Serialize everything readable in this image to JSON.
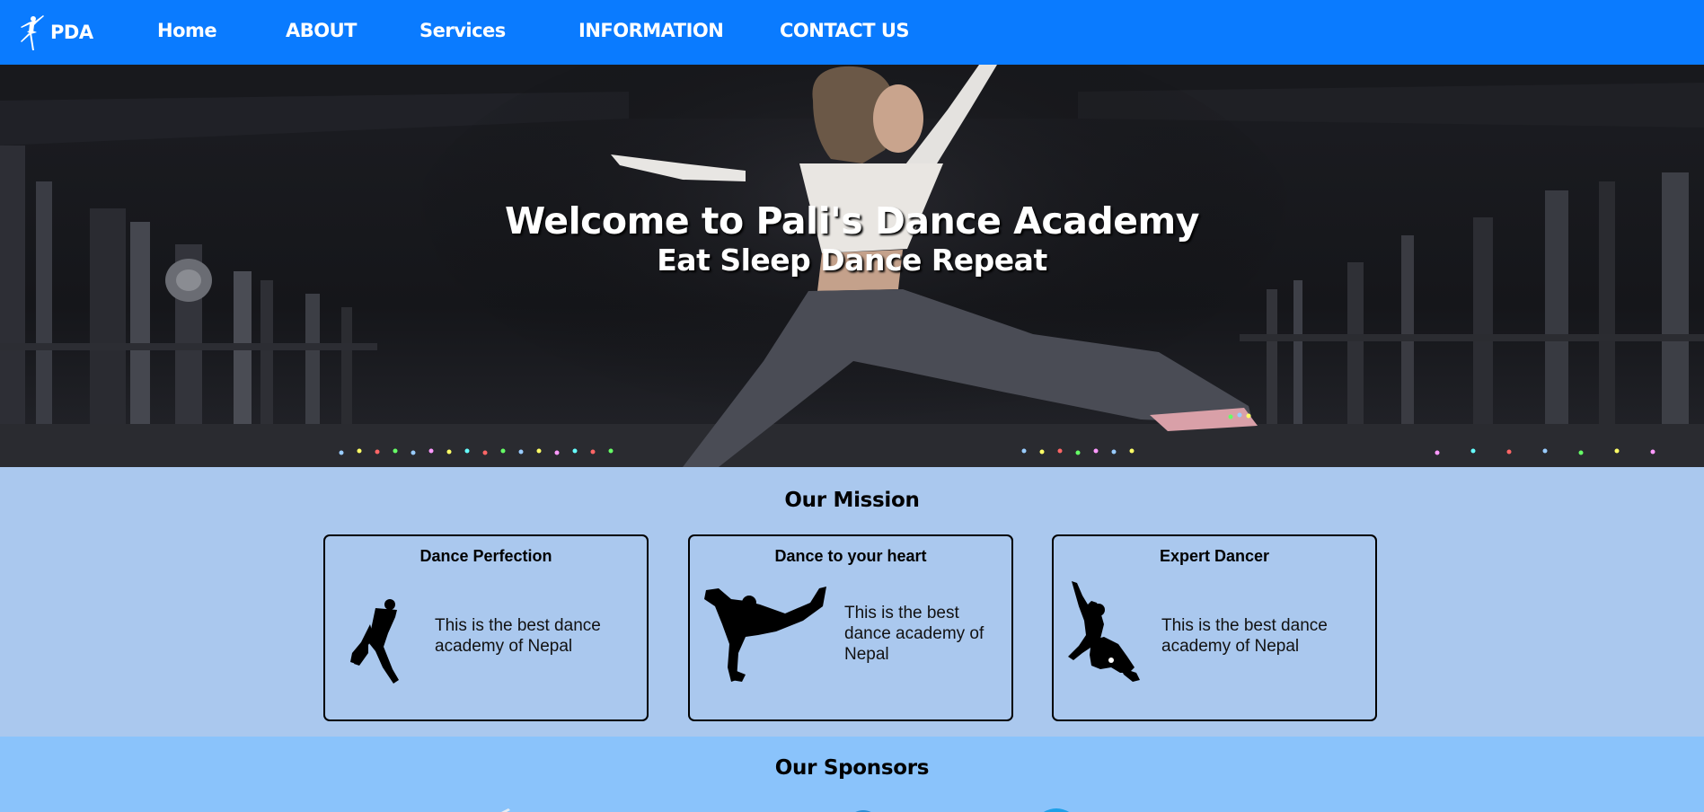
{
  "navbar": {
    "brand": "PDA",
    "links": [
      "Home",
      "ABOUT",
      "Services",
      "INFORMATION",
      "CONTACT US"
    ]
  },
  "hero": {
    "title": "Welcome to Pali's Dance Academy",
    "subtitle": "Eat Sleep Dance Repeat"
  },
  "mission": {
    "title": "Our Mission",
    "cards": [
      {
        "title": "Dance Perfection",
        "text": "This is the best dance academy of Nepal"
      },
      {
        "title": "Dance to your heart",
        "text": "This is the best dance academy of Nepal"
      },
      {
        "title": "Expert Dancer",
        "text": "This is the best dance academy of Nepal"
      }
    ]
  },
  "sponsors": {
    "title": "Our Sponsors"
  },
  "colors": {
    "navbar": "#0a7bff",
    "mission_bg": "#aac8ee",
    "sponsors_bg": "#8ac3fb"
  }
}
